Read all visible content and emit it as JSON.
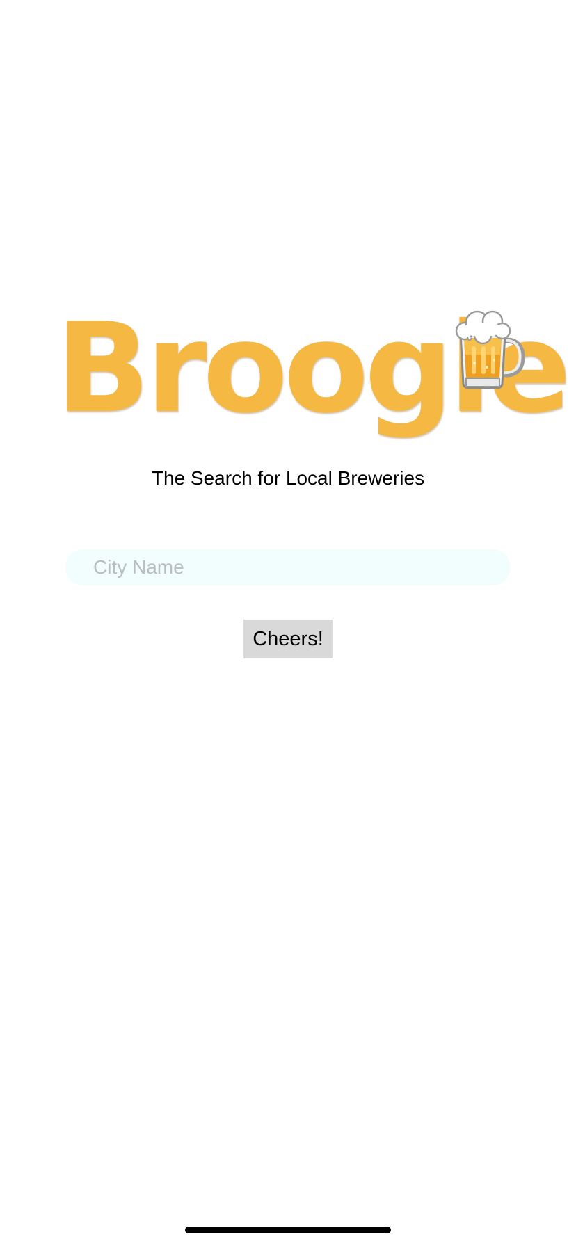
{
  "app": {
    "logo_text": "Broogle",
    "logo_icon": "beer-mug-icon",
    "tagline": "The Search for Local Breweries"
  },
  "search": {
    "placeholder": "City Name",
    "value": ""
  },
  "actions": {
    "submit_label": "Cheers!"
  },
  "colors": {
    "logo": "#f4b843",
    "input_background": "#f2fdfd",
    "placeholder": "#b9bfc0",
    "button_background": "#d9d9d9",
    "text": "#000000"
  }
}
